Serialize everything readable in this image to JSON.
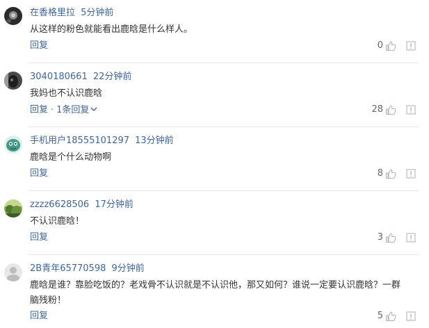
{
  "comments": [
    {
      "user": "在香格里拉",
      "time": "5分钟前",
      "text": "从这样的粉色就能看出鹿晗是什么样人。",
      "reply": "回复",
      "likes": "0",
      "avatar": "dark-flower-avatar"
    },
    {
      "user": "3040180661",
      "time": "22分钟前",
      "text": "我妈也不认识鹿晗",
      "reply": "回复",
      "replies_link": "1条回复",
      "likes": "28",
      "avatar": "dark-portrait-avatar"
    },
    {
      "user": "手机用户18555101297",
      "time": "13分钟前",
      "text": "鹿晗是个什么动物啊",
      "reply": "回复",
      "likes": "8",
      "avatar": "green-cartoon-avatar"
    },
    {
      "user": "zzzz6628506",
      "time": "17分钟前",
      "text": "不认识鹿晗！",
      "reply": "回复",
      "likes": "3",
      "avatar": "green-landscape-avatar"
    },
    {
      "user": "2B青年65770598",
      "time": "9分钟前",
      "text": "鹿晗是谁？靠脸吃饭的？老戏骨不认识就是不认识他，那又如何？谁说一定要认识鹿晗？一群脑残粉！",
      "reply": "回复",
      "likes": "5",
      "avatar": "default-gray-avatar"
    }
  ],
  "colors": {
    "link": "#406599",
    "text": "#333333",
    "divider": "#e6e6e6",
    "icon": "#b4b4b4"
  }
}
